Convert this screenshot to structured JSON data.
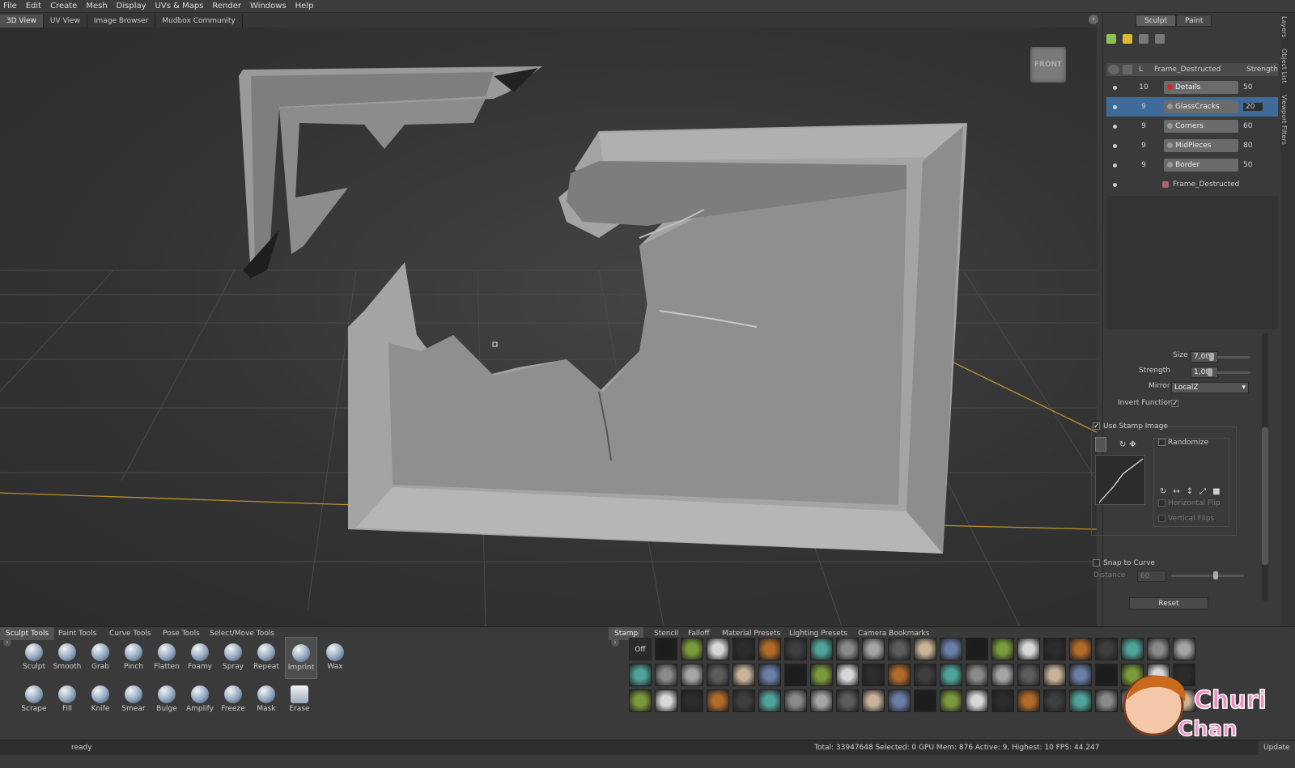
{
  "menu": [
    "File",
    "Edit",
    "Create",
    "Mesh",
    "Display",
    "UVs & Maps",
    "Render",
    "Windows",
    "Help"
  ],
  "view_tabs": [
    "3D View",
    "UV View",
    "Image Browser",
    "Mudbox Community"
  ],
  "viewcube_label": "FRONT",
  "panel_modes": [
    "Sculpt",
    "Paint"
  ],
  "side_tabs": [
    "Layers",
    "Object List",
    "Viewport Filters"
  ],
  "layers": {
    "header": {
      "L": "L",
      "name": "Frame_Destructed",
      "strength": "Strength"
    },
    "rows": [
      {
        "num": "10",
        "name": "Details",
        "strength": "50",
        "selected": false,
        "red": true
      },
      {
        "num": "9",
        "name": "GlassCracks",
        "strength": "20",
        "selected": true,
        "red": false
      },
      {
        "num": "9",
        "name": "Corners",
        "strength": "60",
        "selected": false,
        "red": false
      },
      {
        "num": "9",
        "name": "MidPieces",
        "strength": "80",
        "selected": false,
        "red": false
      },
      {
        "num": "9",
        "name": "Border",
        "strength": "50",
        "selected": false,
        "red": false
      }
    ],
    "base_mesh": "Frame_Destructed"
  },
  "properties": {
    "size_label": "Size",
    "size_value": "7,00",
    "strength_label": "Strength",
    "strength_value": "1,00",
    "mirror_label": "Mirror",
    "mirror_value": "LocalZ",
    "invert_label": "Invert Function",
    "use_stamp_label": "Use Stamp Image",
    "randomize_label": "Randomize",
    "hflip_label": "Horizontal Flip",
    "vflip_label": "Vertical Flips",
    "snap_label": "Snap to Curve",
    "distance_label": "Distance",
    "distance_value": "60",
    "reset_label": "Reset"
  },
  "tool_tabs": [
    "Sculpt Tools",
    "Paint Tools",
    "Curve Tools",
    "Pose Tools",
    "Select/Move Tools"
  ],
  "tools_row1": [
    "Sculpt",
    "Smooth",
    "Grab",
    "Pinch",
    "Flatten",
    "Foamy",
    "Spray",
    "Repeat",
    "Imprint",
    "Wax"
  ],
  "tools_row2": [
    "Scrape",
    "Fill",
    "Knife",
    "Smear",
    "Bulge",
    "Amplify",
    "Freeze",
    "Mask",
    "Erase"
  ],
  "selected_tool": "Imprint",
  "tray_tabs": [
    "Stamp",
    "Stencil",
    "Falloff",
    "Material Presets",
    "Lighting Presets",
    "Camera Bookmarks"
  ],
  "stamp_off": "Off",
  "status": {
    "ready": "ready",
    "stats": "Total: 33947648  Selected: 0 GPU Mem: 876  Active: 9, Highest: 10  FPS: 44.247",
    "update": "Update"
  },
  "watermark": "Churi Chan",
  "colors": {
    "selection": "#3e6b9a",
    "red_layer": "#d22222",
    "axis": "#b8902c"
  }
}
